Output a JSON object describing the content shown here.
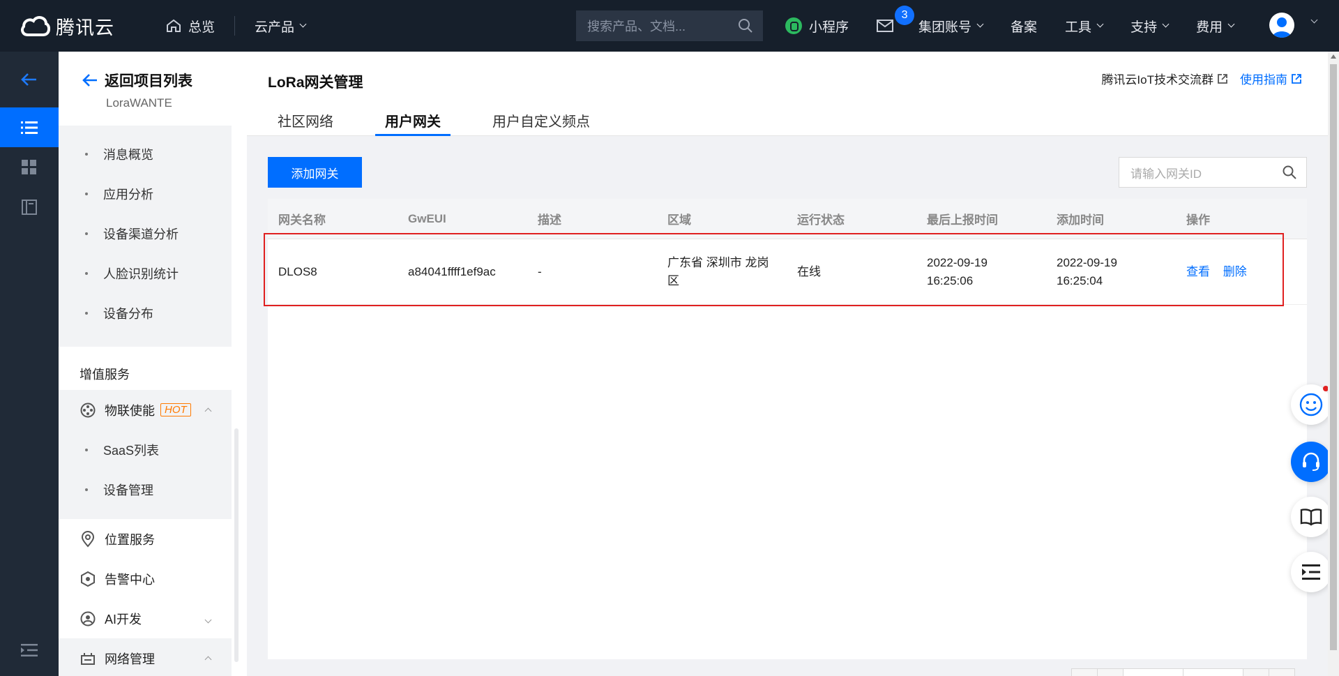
{
  "topbar": {
    "brand": "腾讯云",
    "home_label": "总览",
    "products_label": "云产品",
    "search_placeholder": "搜索产品、文档...",
    "miniprogram_label": "小程序",
    "mail_badge": "3",
    "account_label": "集团账号",
    "record_label": "备案",
    "tools_label": "工具",
    "support_label": "支持",
    "billing_label": "费用"
  },
  "sidebar": {
    "back_label": "返回项目列表",
    "project_name": "LoraWANTE",
    "sub_items": [
      "消息概览",
      "应用分析",
      "设备渠道分析",
      "人脸识别统计",
      "设备分布"
    ],
    "section_label": "增值服务",
    "iot_label": "物联使能",
    "hot_label": "HOT",
    "iot_items": [
      "SaaS列表",
      "设备管理"
    ],
    "location_label": "位置服务",
    "alarm_label": "告警中心",
    "ai_label": "AI开发",
    "network_label": "网络管理"
  },
  "main": {
    "title": "LoRa网关管理",
    "link_group": "腾讯云IoT技术交流群",
    "link_guide": "使用指南",
    "tabs": [
      "社区网络",
      "用户网关",
      "用户自定义频点"
    ],
    "active_tab": "用户网关",
    "add_button": "添加网关",
    "search_placeholder": "请输入网关ID"
  },
  "table": {
    "headers": [
      "网关名称",
      "GwEUI",
      "描述",
      "区域",
      "运行状态",
      "最后上报时间",
      "添加时间",
      "操作"
    ],
    "rows": [
      {
        "name": "DLOS8",
        "gweui": "a84041ffff1ef9ac",
        "desc": "-",
        "region": "广东省 深圳市 龙岗区",
        "status": "在线",
        "last_report": "2022-09-19 16:25:06",
        "added": "2022-09-19 16:25:04",
        "op_view": "查看",
        "op_delete": "删除"
      }
    ]
  },
  "colors": {
    "accent": "#006eff",
    "topbar_bg": "#161f2b",
    "highlight": "#e02020",
    "hot": "#ff7a00"
  }
}
